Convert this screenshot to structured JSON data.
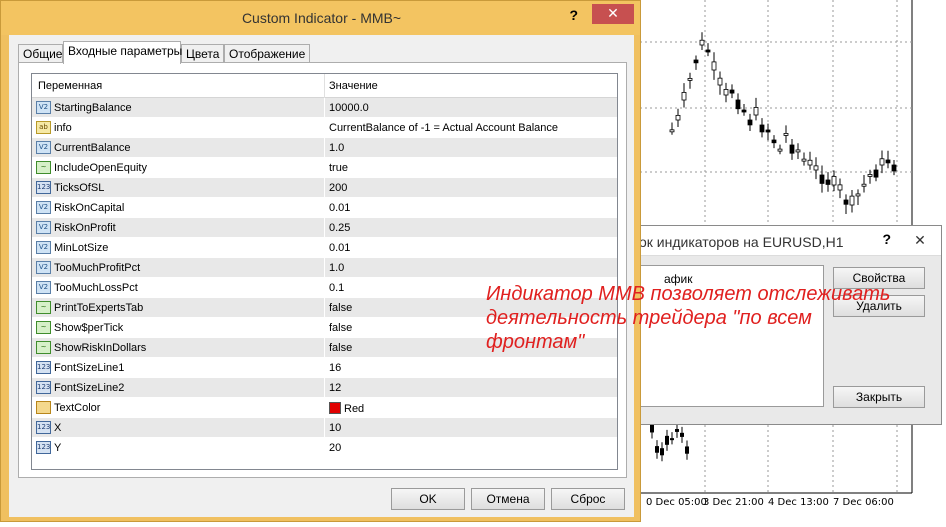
{
  "chart": {
    "x_labels": [
      "0 Dec 05:00",
      "3 Dec 21:00",
      "4 Dec 13:00",
      "7 Dec 06:00"
    ]
  },
  "list_dialog": {
    "title": "ок индикаторов на EURUSD,H1",
    "help": "?",
    "close": "✕",
    "list_item": "афик",
    "properties_button": "Свойства",
    "delete_button": "Удалить",
    "close_button": "Закрыть"
  },
  "dialog": {
    "title": "Custom Indicator - MMB~",
    "help": "?",
    "close": "✕",
    "tabs": [
      "Общие",
      "Входные параметры",
      "Цвета",
      "Отображение"
    ],
    "columns": {
      "name": "Переменная",
      "value": "Значение"
    },
    "params": [
      {
        "type": "double",
        "icon": "V2",
        "name": "StartingBalance",
        "value": "10000.0"
      },
      {
        "type": "string",
        "icon": "ab",
        "name": "info",
        "value": "CurrentBalance of -1 = Actual Account Balance"
      },
      {
        "type": "double",
        "icon": "V2",
        "name": "CurrentBalance",
        "value": "1.0"
      },
      {
        "type": "bool",
        "icon": "~",
        "name": "IncludeOpenEquity",
        "value": "true"
      },
      {
        "type": "int",
        "icon": "123",
        "name": "TicksOfSL",
        "value": "200"
      },
      {
        "type": "double",
        "icon": "V2",
        "name": "RiskOnCapital",
        "value": "0.01"
      },
      {
        "type": "double",
        "icon": "V2",
        "name": "RiskOnProfit",
        "value": "0.25"
      },
      {
        "type": "double",
        "icon": "V2",
        "name": "MinLotSize",
        "value": "0.01"
      },
      {
        "type": "double",
        "icon": "V2",
        "name": "TooMuchProfitPct",
        "value": "1.0"
      },
      {
        "type": "double",
        "icon": "V2",
        "name": "TooMuchLossPct",
        "value": "0.1"
      },
      {
        "type": "bool",
        "icon": "~",
        "name": "PrintToExpertsTab",
        "value": "false"
      },
      {
        "type": "bool",
        "icon": "~",
        "name": "Show$perTick",
        "value": "false"
      },
      {
        "type": "bool",
        "icon": "~",
        "name": "ShowRiskInDollars",
        "value": "false"
      },
      {
        "type": "int",
        "icon": "123",
        "name": "FontSizeLine1",
        "value": "16"
      },
      {
        "type": "int",
        "icon": "123",
        "name": "FontSizeLine2",
        "value": "12"
      },
      {
        "type": "color",
        "icon": "",
        "name": "TextColor",
        "value": "Red",
        "swatch": "#e00000"
      },
      {
        "type": "int",
        "icon": "123",
        "name": "X",
        "value": "10"
      },
      {
        "type": "int",
        "icon": "123",
        "name": "Y",
        "value": "20"
      }
    ],
    "ok_button": "OK",
    "cancel_button": "Отмена",
    "reset_button": "Сброс"
  },
  "annotation": "Индикатор MMB позволяет отслеживать деятельность трейдера \"по всем фронтам\""
}
